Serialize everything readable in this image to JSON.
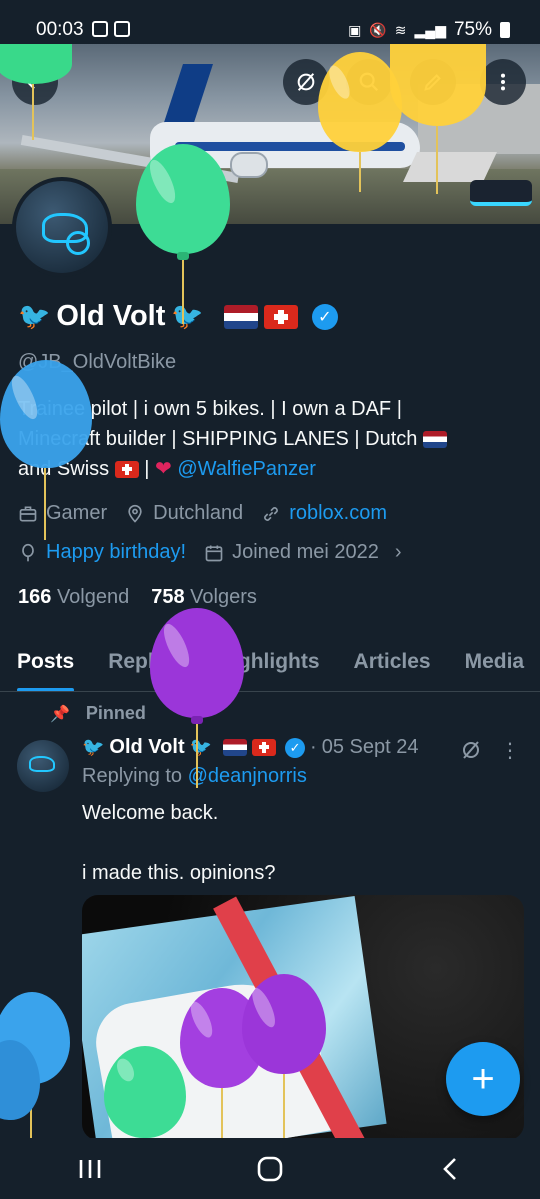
{
  "status_bar": {
    "time": "00:03",
    "battery": "75%"
  },
  "profile": {
    "display_name": "Old Volt",
    "handle": "@JB_OldVoltBike",
    "bio_line1": "Trainee pilot | i own 5 bikes. | I own a DAF |",
    "bio_line2": "Minecraft builder | SHIPPING LANES | Dutch",
    "bio_line3_pre": "and Swiss",
    "bio_line3_sep": "|",
    "bio_mention": "@WalfiePanzer",
    "category": "Gamer",
    "location": "Dutchland",
    "website": "roblox.com",
    "birthday": "Happy birthday!",
    "joined": "Joined mei 2022",
    "following_count": "166",
    "following_label": "Volgend",
    "followers_count": "758",
    "followers_label": "Volgers"
  },
  "tabs": [
    "Posts",
    "Replies",
    "Highlights",
    "Articles",
    "Media"
  ],
  "post": {
    "pinned_label": "Pinned",
    "author": "Old Volt",
    "dot": "·",
    "date": "05 Sept 24",
    "replying_prefix": "Replying to",
    "replying_handle": "@deanjnorris",
    "text_line1": "Welcome back.",
    "text_line2": "i made this. opinions?"
  },
  "fab": {
    "label": "+"
  },
  "colors": {
    "background": "#15202b",
    "accent": "#1d9bf0",
    "secondary_text": "#8b98a5"
  }
}
